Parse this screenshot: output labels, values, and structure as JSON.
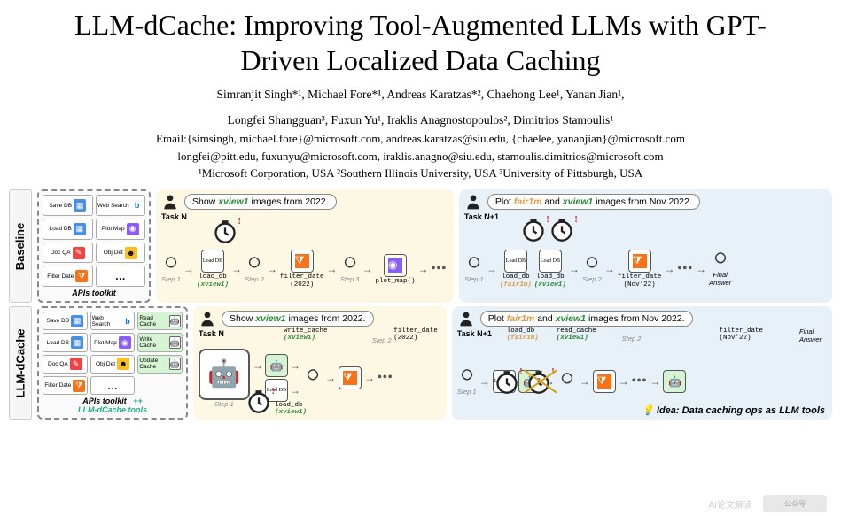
{
  "title": "LLM-dCache: Improving Tool-Augmented LLMs with GPT-Driven Localized Data Caching",
  "authors_line1": "Simranjit Singh*¹, Michael Fore*¹, Andreas Karatzas*², Chaehong Lee¹, Yanan Jian¹,",
  "authors_line2": "Longfei Shangguan³, Fuxun Yu¹, Iraklis Anagnostopoulos², Dimitrios Stamoulis¹",
  "emails_line1": "Email:{simsingh, michael.fore}@microsoft.com, andreas.karatzas@siu.edu, {chaelee, yananjian}@microsoft.com",
  "emails_line2": "longfei@pitt.edu, fuxunyu@microsoft.com, iraklis.anagno@siu.edu, stamoulis.dimitrios@microsoft.com",
  "affils": "¹Microsoft Corporation, USA   ²Southern Illinois University, USA   ³University of Pittsburgh, USA",
  "labels": {
    "baseline": "Baseline",
    "dcache": "LLM-dCache"
  },
  "toolkit": {
    "caption": "APIs toolkit",
    "dcache_caption_plus": "++",
    "dcache_caption": "LLM-dCache tools",
    "apis": {
      "save_db": "Save DB",
      "web_search": "Web Search",
      "load_db": "Load DB",
      "plot_map": "Plot Map",
      "doc_qa": "Doc QA",
      "obj_det": "Obj Det",
      "filter_date": "Filter Date",
      "dots": "…",
      "read_cache": "Read Cache",
      "write_cache": "Write Cache",
      "update_cache": "Update Cache"
    }
  },
  "tasks": {
    "n_label": "Task N",
    "n1_label": "Task N+1",
    "prompt_n_prefix": "Show ",
    "prompt_n_xview": "xview1",
    "prompt_n_suffix": " images from 2022.",
    "prompt_n1_prefix": "Plot ",
    "prompt_n1_fair": "fair1m",
    "prompt_n1_and": " and ",
    "prompt_n1_xview": "xview1",
    "prompt_n1_suffix": " images from Nov 2022."
  },
  "steps": {
    "step1": "Step 1",
    "step2": "Step 2",
    "step3": "Step 3",
    "load_db_xv": "load_db",
    "load_db_xv_arg": "(xview1)",
    "load_db_fm": "load_db",
    "load_db_fm_arg": "(fair1m)",
    "filter_date_2022": "filter_date",
    "filter_date_2022_arg": "(2022)",
    "filter_date_nov": "filter_date",
    "filter_date_nov_arg": "(Nov'22)",
    "plot_map": "plot_map()",
    "write_cache": "write_cache",
    "write_cache_arg": "(xview1)",
    "read_cache": "read_cache",
    "read_cache_arg": "(xview1)",
    "final": "Final",
    "answer": "Answer"
  },
  "idea": {
    "lamp": "💡",
    "prefix": "Idea: ",
    "text": "Data caching ops as LLM tools"
  },
  "watermark": "AI论文解读",
  "wm_badge": "公众号"
}
